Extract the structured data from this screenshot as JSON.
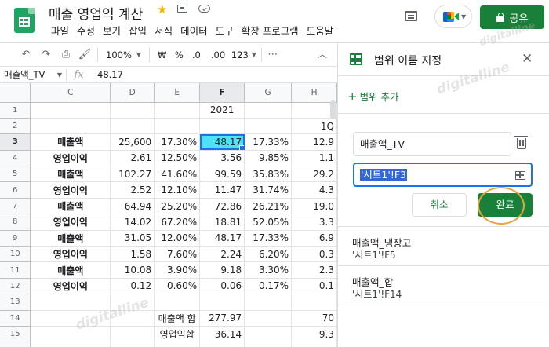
{
  "doc": {
    "title": "매출 영업익 계산"
  },
  "menu": [
    "파일",
    "수정",
    "보기",
    "삽입",
    "서식",
    "데이터",
    "도구",
    "확장 프로그램",
    "도움말"
  ],
  "header_actions": {
    "share_label": "공유"
  },
  "toolbar": {
    "zoom": "100%",
    "currency": "₩",
    "percent": "%",
    "dec_decrease": ".0",
    "dec_increase": ".00",
    "format": "123"
  },
  "formula_bar": {
    "name_box": "매출액_TV",
    "fx": "fx",
    "value": "48.17"
  },
  "sheet": {
    "columns": [
      "C",
      "D",
      "E",
      "F",
      "G",
      "H"
    ],
    "selected_column": "F",
    "selected_row": "3",
    "rows": [
      {
        "n": "1",
        "cells": [
          "",
          "",
          "",
          "2021",
          "",
          ""
        ]
      },
      {
        "n": "2",
        "cells": [
          "",
          "",
          "",
          "",
          "",
          "1Q"
        ]
      },
      {
        "n": "3",
        "cells": [
          "매출액",
          "25,600",
          "17.30%",
          "48.17",
          "17.33%",
          "12.9"
        ]
      },
      {
        "n": "4",
        "cells": [
          "영업이익",
          "2.61",
          "12.50%",
          "3.56",
          "9.85%",
          "1.1"
        ]
      },
      {
        "n": "5",
        "cells": [
          "매출액",
          "102.27",
          "41.60%",
          "99.59",
          "35.83%",
          "29.2"
        ]
      },
      {
        "n": "6",
        "cells": [
          "영업이익",
          "2.52",
          "12.10%",
          "11.47",
          "31.74%",
          "4.3"
        ]
      },
      {
        "n": "7",
        "cells": [
          "매출액",
          "64.94",
          "25.20%",
          "72.86",
          "26.21%",
          "19.0"
        ]
      },
      {
        "n": "8",
        "cells": [
          "영업이익",
          "14.02",
          "67.20%",
          "18.81",
          "52.05%",
          "3.3"
        ]
      },
      {
        "n": "9",
        "cells": [
          "매출액",
          "31.05",
          "12.00%",
          "48.17",
          "17.33%",
          "6.9"
        ]
      },
      {
        "n": "10",
        "cells": [
          "영업이익",
          "1.58",
          "7.60%",
          "2.24",
          "6.20%",
          "0.3"
        ]
      },
      {
        "n": "11",
        "cells": [
          "매출액",
          "10.08",
          "3.90%",
          "9.18",
          "3.30%",
          "2.3"
        ]
      },
      {
        "n": "12",
        "cells": [
          "영업이익",
          "0.12",
          "0.60%",
          "0.06",
          "0.17%",
          "0.1"
        ]
      },
      {
        "n": "13",
        "cells": [
          "",
          "",
          "",
          "",
          "",
          ""
        ]
      },
      {
        "n": "14",
        "cells": [
          "",
          "",
          "매출액 합",
          "277.97",
          "",
          "70"
        ]
      },
      {
        "n": "15",
        "cells": [
          "",
          "",
          "영업익합",
          "36.14",
          "",
          "9.3"
        ]
      },
      {
        "n": "16",
        "cells": [
          "",
          "",
          "",
          "",
          "",
          ""
        ]
      }
    ]
  },
  "panel": {
    "title": "범위 이름 지정",
    "add_range": "범위 추가",
    "name_value": "매출액_TV",
    "range_value": "'시트1'!F3",
    "cancel_label": "취소",
    "done_label": "완료",
    "named_ranges": [
      {
        "name": "매출액_냉장고",
        "range": "'시트1'!F5"
      },
      {
        "name": "매출액_합",
        "range": "'시트1'!F14"
      }
    ]
  },
  "watermark": "digitalline",
  "colors": {
    "brand_green": "#188038",
    "selected_cell": "#4ee0f5",
    "focus_blue": "#1a73e8",
    "highlight_ring": "#e8a33d"
  }
}
